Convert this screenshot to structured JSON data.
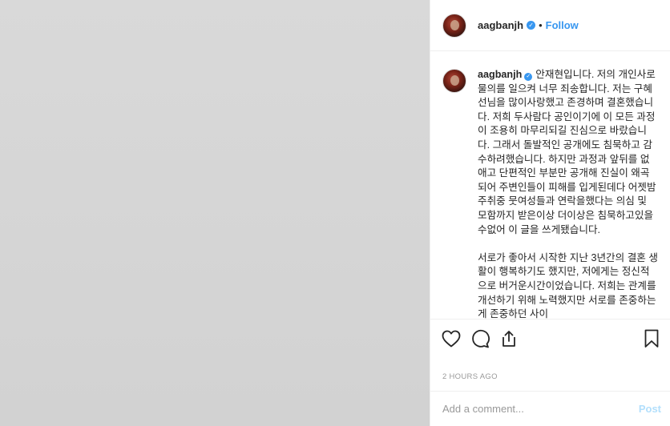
{
  "post": {
    "username": "aagbanjh",
    "follow_label": "Follow",
    "separator": "•",
    "verified_glyph": "✓",
    "caption": "안재현입니다. 저의 개인사로 물의를 일으켜 너무 죄송합니다. 저는 구혜선님을 많이사랑했고 존경하며 결혼했습니다. 저희 두사람다 공인이기에 이 모든 과정이 조용히 마무리되길 진심으로 바랐습니다. 그래서 돌발적인 공개에도 침묵하고 감수하려했습니다. 하지만 과정과 앞뒤를 없애고 단편적인 부분만 공개해 진실이 왜곡되어 주변인들이 피해를 입게된데다 어젯밤 주취중 뭇여성들과 연락을했다는 의심 및 모함까지 받은이상 더이상은 침묵하고있을수없어 이 글을 쓰게됐습니다.\n\n서로가 좋아서 시작한 지난 3년간의 결혼 생활이 행복하기도 했지만, 저에게는 정신적으로 버거운시간이었습니다. 저희는 관계를 개선하기 위해 노력했지만 서로를 존중하는 게 존중하던 사이",
    "timestamp": "2 HOURS AGO"
  },
  "comment": {
    "placeholder": "Add a comment...",
    "post_label": "Post"
  },
  "icons": {
    "like": "heart-icon",
    "comment": "comment-bubble-icon",
    "share": "share-icon",
    "save": "bookmark-icon",
    "verified": "verified-badge-icon"
  },
  "colors": {
    "accent": "#3897f0",
    "post_disabled": "#b2dffc",
    "muted": "#999999",
    "media_placeholder": "#d6d6d6"
  }
}
